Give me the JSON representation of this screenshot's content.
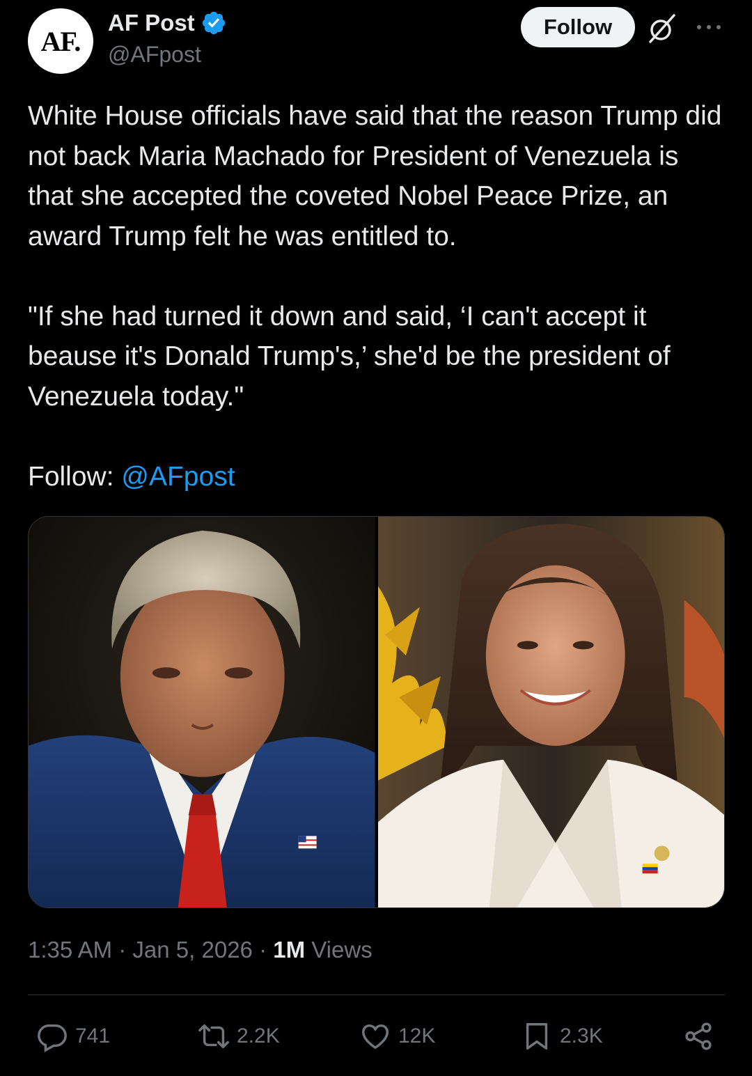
{
  "author": {
    "avatar_text": "AF.",
    "display_name": "AF Post",
    "handle": "@AFpost",
    "verified": true
  },
  "header": {
    "follow_label": "Follow"
  },
  "tweet": {
    "paragraphs": [
      "White House officials have said that the reason Trump did not back Maria Machado for President of Venezuela is that she accepted the coveted Nobel Peace Prize, an award Trump felt he was entitled to.",
      "\"If she had turned it down and said, ‘I can't accept it beause it's Donald Trump's,’ she'd be the president of Venezuela today.\""
    ],
    "follow_prefix": "Follow: ",
    "follow_mention": "@AFpost"
  },
  "meta": {
    "time": "1:35 AM",
    "date": "Jan 5, 2026",
    "views_count": "1M",
    "views_label": "Views"
  },
  "actions": {
    "replies": "741",
    "reposts": "2.2K",
    "likes": "12K",
    "bookmarks": "2.3K"
  },
  "colors": {
    "background": "#000000",
    "text": "#e7e9ea",
    "secondary": "#71767b",
    "link": "#1d9bf0",
    "verified": "#1d9bf0"
  }
}
